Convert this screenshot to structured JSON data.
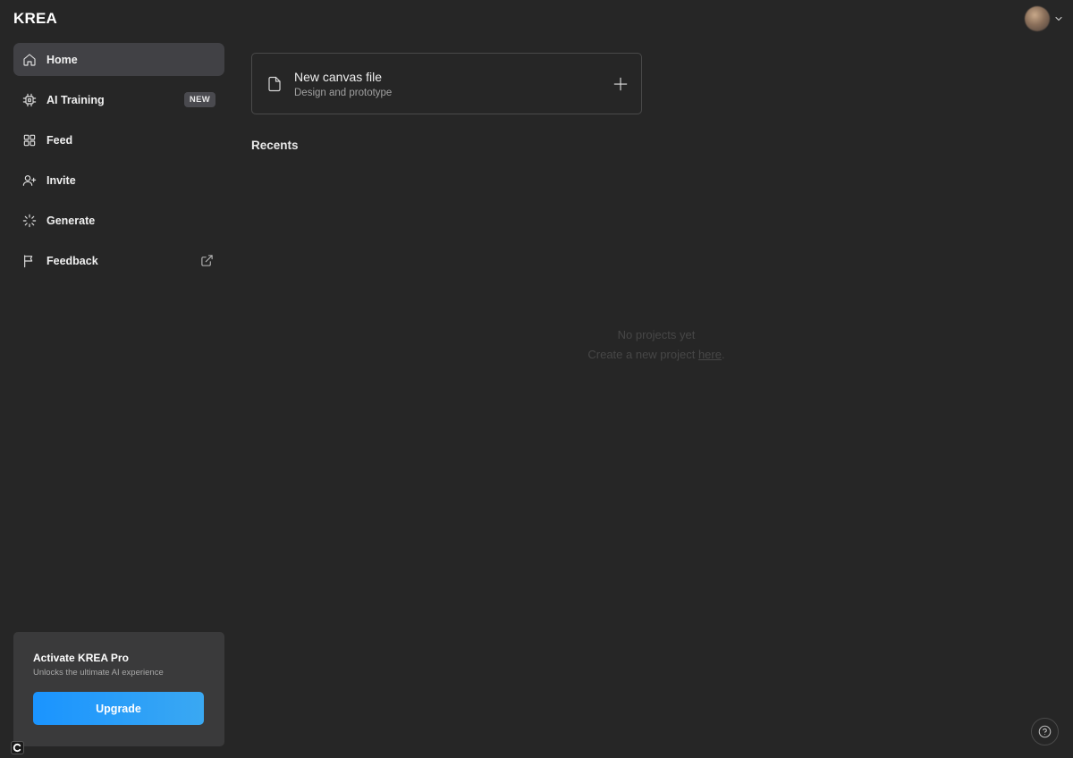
{
  "app": {
    "logo": "KREA"
  },
  "account": {
    "avatar": "user-avatar",
    "menu_icon": "chevron-down-icon"
  },
  "sidebar": {
    "items": [
      {
        "label": "Home",
        "icon": "home-icon",
        "active": true
      },
      {
        "label": "AI Training",
        "icon": "cpu-icon",
        "badge": "NEW"
      },
      {
        "label": "Feed",
        "icon": "grid-icon"
      },
      {
        "label": "Invite",
        "icon": "user-plus-icon"
      },
      {
        "label": "Generate",
        "icon": "loader-icon"
      },
      {
        "label": "Feedback",
        "icon": "flag-icon",
        "trailing_icon": "external-link-icon"
      }
    ]
  },
  "pro_card": {
    "title": "Activate KREA Pro",
    "subtitle": "Unlocks the ultimate AI experience",
    "button": "Upgrade"
  },
  "main": {
    "new_canvas": {
      "title": "New canvas file",
      "subtitle": "Design and prototype"
    },
    "recents_title": "Recents",
    "empty": {
      "line1": "No projects yet",
      "line2_prefix": "Create a new project ",
      "line2_link": "here",
      "line2_suffix": "."
    }
  },
  "colors": {
    "background": "#262626",
    "accent": "#1a94ff",
    "active_item": "#414145"
  }
}
